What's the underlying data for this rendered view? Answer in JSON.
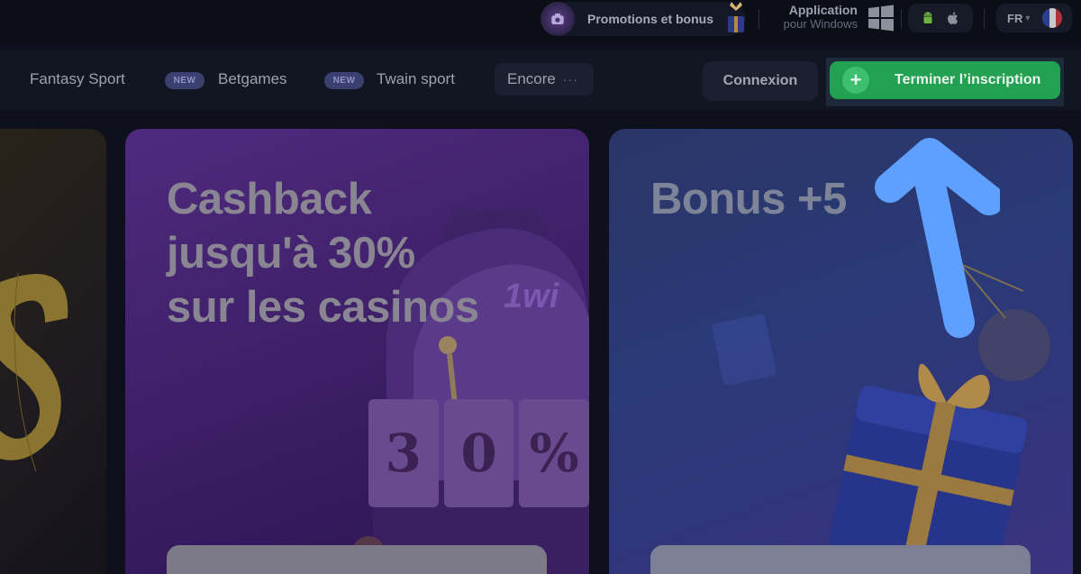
{
  "topbar": {
    "promo_label": "Promotions et bonus",
    "promo_icon": "camera-icon",
    "app_title": "Application",
    "app_subtitle": "pour Windows",
    "windows_icon": "windows-icon",
    "os_icons": [
      "android-icon",
      "apple-icon"
    ],
    "language": "FR",
    "flag": "france-flag-icon"
  },
  "nav": {
    "items": [
      {
        "label": "Fantasy Sport"
      },
      {
        "label": "Betgames",
        "badge": "NEW"
      },
      {
        "label": "Twain sport",
        "badge": "NEW"
      }
    ],
    "more_label": "Encore",
    "more_icon": "more-dots-icon",
    "login_label": "Connexion",
    "register_label": "Terminer l’inscription",
    "register_icon": "plus-icon"
  },
  "cards": {
    "cashback_title_lines": [
      "Cashback",
      "jusqu'à 30%",
      "sur les casinos"
    ],
    "slot_reel_labels": [
      "3",
      "0",
      "%"
    ],
    "slot_brand": "1wi",
    "bonus_title": "Bonus +5"
  },
  "overlay": {
    "arrow_icon": "up-arrow-icon",
    "arrow_color": "#5fa0ff"
  },
  "colors": {
    "register_green": "#22a152",
    "cashback_purple": "#4f2a7e",
    "bonus_blue": "#2b3566",
    "background": "#0e111b"
  }
}
